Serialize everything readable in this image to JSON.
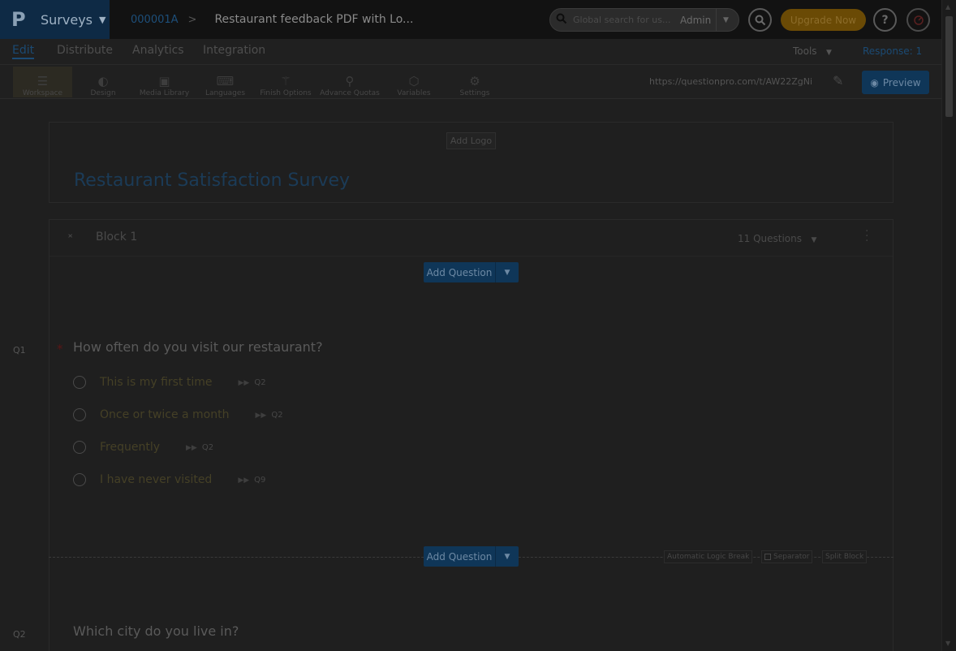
{
  "topbar": {
    "brand_logo": "P",
    "brand_label": "Surveys",
    "survey_id": "000001A",
    "survey_title": "Restaurant feedback PDF with Lo...",
    "search_placeholder": "Global search for us...",
    "search_scope": "Admin",
    "upgrade_label": "Upgrade Now",
    "help_label": "?"
  },
  "nav": {
    "tabs": [
      "Edit",
      "Distribute",
      "Analytics",
      "Integration"
    ],
    "tools_label": "Tools",
    "response_label": "Response: 1"
  },
  "toolbar": {
    "items": [
      "Workspace",
      "Design",
      "Media Library",
      "Languages",
      "Finish Options",
      "Advance Quotas",
      "Variables",
      "Settings"
    ],
    "url": "https://questionpro.com/t/AW22ZgNi",
    "preview_label": "Preview"
  },
  "survey": {
    "add_logo_label": "Add Logo",
    "title": "Restaurant Satisfaction Survey",
    "block_name": "Block 1",
    "question_count": "11 Questions",
    "add_question_label": "Add Question",
    "break_tags": [
      "Automatic Logic Break",
      "Separator",
      "Split Block"
    ],
    "questions": [
      {
        "number": "Q1",
        "text": "How often do you visit our restaurant?",
        "options": [
          {
            "label": "This is my first time",
            "skip_to": "Q2"
          },
          {
            "label": "Once or twice a month",
            "skip_to": "Q2"
          },
          {
            "label": "Frequently",
            "skip_to": "Q2"
          },
          {
            "label": "I have never visited",
            "skip_to": "Q9"
          }
        ]
      },
      {
        "number": "Q2",
        "text": "Which city do you live in?"
      }
    ]
  }
}
